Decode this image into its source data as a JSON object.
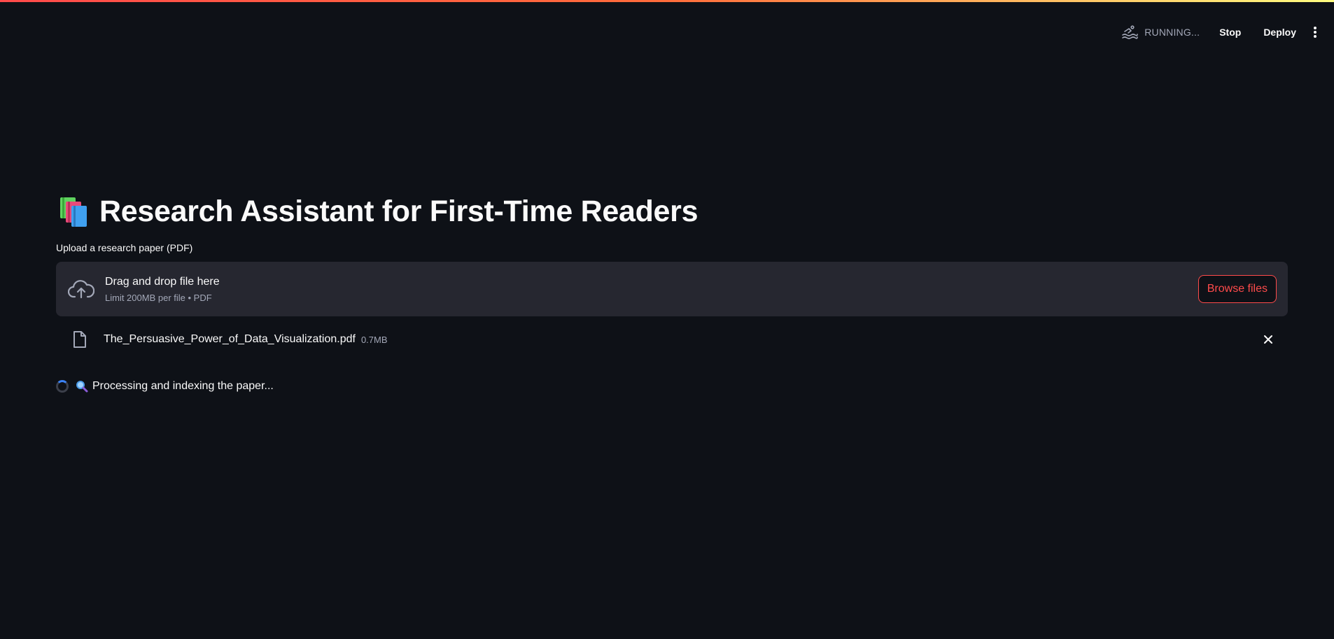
{
  "header": {
    "status_text": "RUNNING...",
    "stop_label": "Stop",
    "deploy_label": "Deploy"
  },
  "main": {
    "title": "Research Assistant for First-Time Readers",
    "title_icon": "books-emoji-icon",
    "uploader": {
      "label": "Upload a research paper (PDF)",
      "drop_title": "Drag and drop file here",
      "drop_subtitle": "Limit 200MB per file • PDF",
      "browse_label": "Browse files"
    },
    "uploaded_file": {
      "name": "The_Persuasive_Power_of_Data_Visualization.pdf",
      "size": "0.7MB"
    },
    "processing": {
      "text": "Processing and indexing the paper..."
    }
  },
  "colors": {
    "background": "#0e1117",
    "panel": "#262730",
    "accent": "#ff4b4b",
    "muted_text": "#a3a8b8",
    "spinner": "#3b82f6"
  }
}
